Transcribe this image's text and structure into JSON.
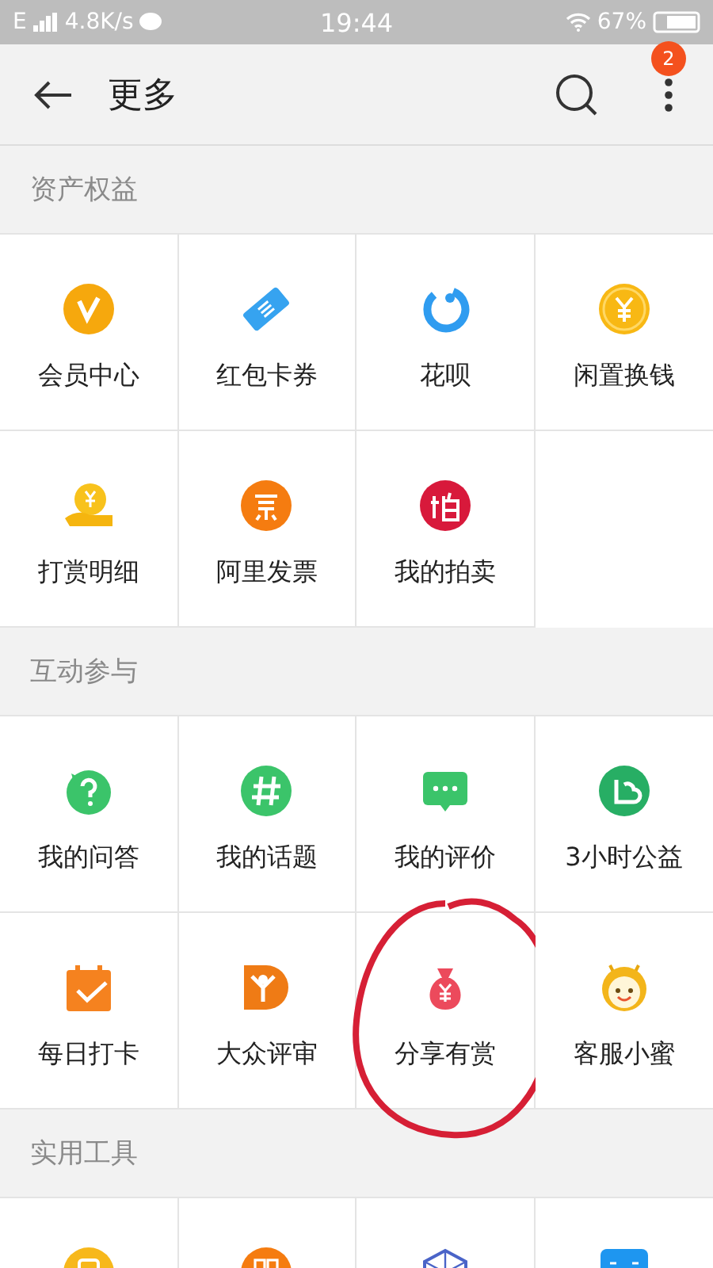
{
  "status_bar": {
    "network": "E",
    "speed": "4.8K/s",
    "time": "19:44",
    "battery": "67%"
  },
  "header": {
    "title": "更多",
    "badge": "2"
  },
  "sections": [
    {
      "title": "资产权益",
      "items": [
        {
          "label": "会员中心",
          "circled": false
        },
        {
          "label": "红包卡券",
          "circled": false
        },
        {
          "label": "花呗",
          "circled": false
        },
        {
          "label": "闲置换钱",
          "circled": false
        },
        {
          "label": "打赏明细",
          "circled": false
        },
        {
          "label": "阿里发票",
          "circled": false
        },
        {
          "label": "我的拍卖",
          "circled": false
        }
      ]
    },
    {
      "title": "互动参与",
      "items": [
        {
          "label": "我的问答",
          "circled": false
        },
        {
          "label": "我的话题",
          "circled": false
        },
        {
          "label": "我的评价",
          "circled": false
        },
        {
          "label": "3小时公益",
          "circled": false
        },
        {
          "label": "每日打卡",
          "circled": false
        },
        {
          "label": "大众评审",
          "circled": false
        },
        {
          "label": "分享有赏",
          "circled": true
        },
        {
          "label": "客服小蜜",
          "circled": false
        }
      ]
    },
    {
      "title": "实用工具",
      "items": [
        {
          "circled": false
        },
        {
          "circled": false
        },
        {
          "circled": false
        },
        {
          "circled": false
        }
      ]
    }
  ]
}
